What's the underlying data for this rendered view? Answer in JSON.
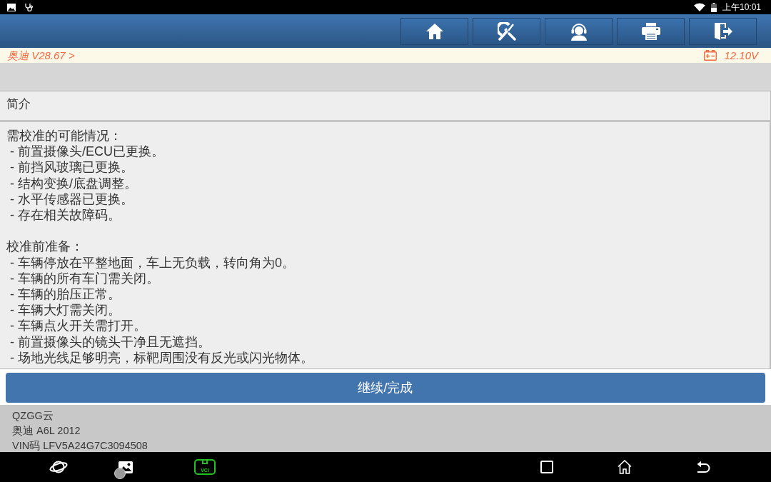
{
  "status_bar": {
    "time": "上午10:01"
  },
  "breadcrumb": {
    "path": "奥迪 V28.67 >",
    "voltage": "12.10V"
  },
  "section": {
    "title": "简介",
    "paragraphs": [
      {
        "heading": "需校准的可能情况：",
        "items": [
          "- 前置摄像头/ECU已更换。",
          "- 前挡风玻璃已更换。",
          "- 结构变换/底盘调整。",
          "- 水平传感器已更换。",
          "- 存在相关故障码。"
        ]
      },
      {
        "heading": "校准前准备：",
        "items": [
          "- 车辆停放在平整地面，车上无负载，转向角为0。",
          "- 车辆的所有车门需关闭。",
          "- 车辆的胎压正常。",
          "- 车辆大灯需关闭。",
          "- 车辆点火开关需打开。",
          "- 前置摄像头的镜头干净且无遮挡。",
          "- 场地光线足够明亮，标靶周围没有反光或闪光物体。"
        ]
      }
    ]
  },
  "primary_button": {
    "label": "继续/完成"
  },
  "vehicle_info": {
    "lines": [
      "QZGG云",
      "奥迪 A6L 2012",
      "VIN码 LFV5A24G7C3094508"
    ]
  },
  "nav_bar": {
    "vci_label": "VCI"
  }
}
